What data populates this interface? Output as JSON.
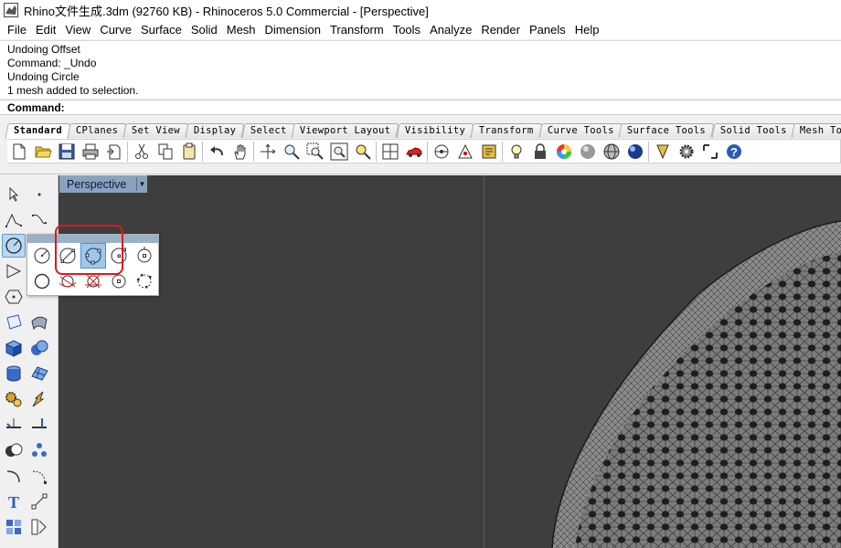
{
  "window": {
    "title": "Rhino文件生成.3dm (92760 KB) - Rhinoceros 5.0 Commercial - [Perspective]",
    "app_icon": "rhino-icon"
  },
  "menubar": {
    "items": [
      "File",
      "Edit",
      "View",
      "Curve",
      "Surface",
      "Solid",
      "Mesh",
      "Dimension",
      "Transform",
      "Tools",
      "Analyze",
      "Render",
      "Panels",
      "Help"
    ]
  },
  "history": {
    "lines": [
      "Undoing Offset",
      "Command: _Undo",
      "Undoing Circle",
      "1 mesh added to selection."
    ]
  },
  "command": {
    "label": "Command:",
    "value": ""
  },
  "toolbar": {
    "tabs": [
      "Standard",
      "CPlanes",
      "Set View",
      "Display",
      "Select",
      "Viewport Layout",
      "Visibility",
      "Transform",
      "Curve Tools",
      "Surface Tools",
      "Solid Tools",
      "Mesh Tool"
    ],
    "active_tab": "Standard"
  },
  "viewport": {
    "label": "Perspective",
    "background": "#3e3e3e"
  },
  "colors": {
    "highlight": "#e01818",
    "selected_tool": "#9cc8ef",
    "viewport_tab": "#8aa2bf"
  }
}
